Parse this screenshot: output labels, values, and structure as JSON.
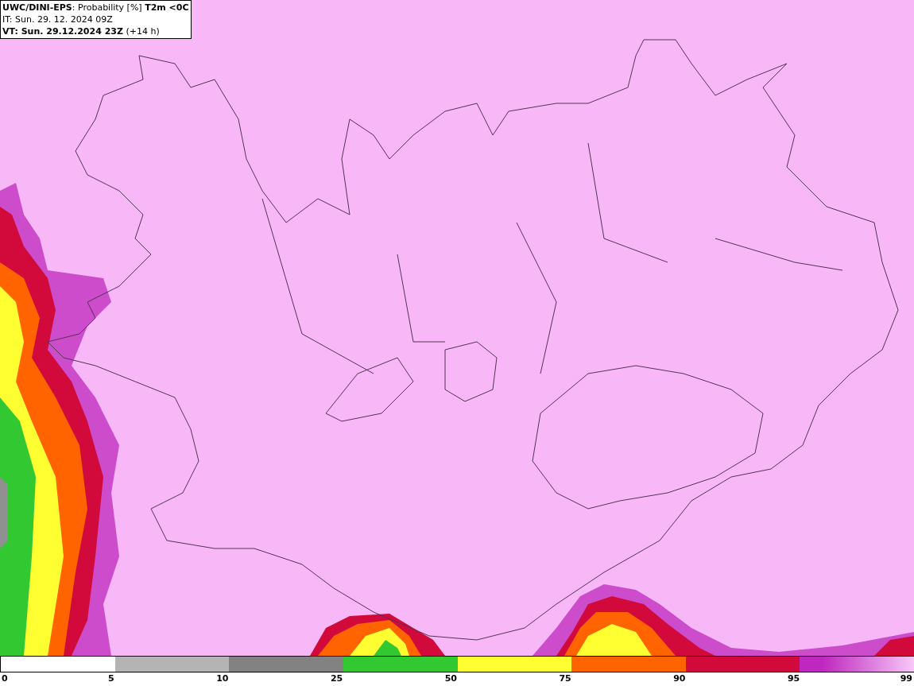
{
  "header": {
    "lines": [
      "**UWC/DINI-EPS**: Probability [%] **T2m <0C**",
      "IT: Sun. 29. 12. 2024 09Z",
      "**VT: Sun. 29.12.2024 23Z** (+14 h)"
    ]
  },
  "legend": {
    "segments": [
      {
        "color": "#ffffff"
      },
      {
        "color": "#b4b4b4"
      },
      {
        "color": "#828282"
      },
      {
        "color": "#32c832"
      },
      {
        "color": "#ffff32"
      },
      {
        "color": "#ff6400"
      },
      {
        "color": "#d20a3c"
      },
      {
        "color": "#be28be"
      }
    ],
    "labels": [
      "0",
      "5",
      "10",
      "25",
      "50",
      "75",
      "90",
      "95",
      "99"
    ]
  }
}
